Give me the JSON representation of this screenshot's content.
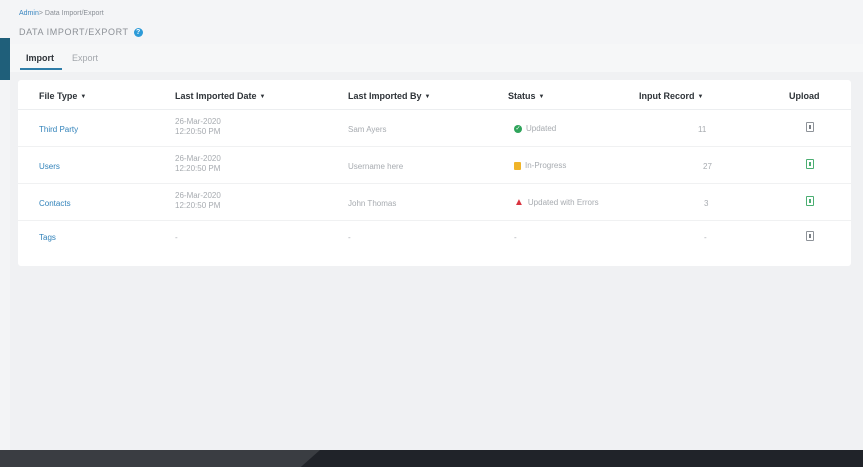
{
  "breadcrumb": {
    "link": "Admin",
    "separator": ">",
    "current": "Data Import/Export"
  },
  "page": {
    "title": "DATA IMPORT/EXPORT",
    "help_glyph": "?"
  },
  "tabs": [
    {
      "label": "Import",
      "active": true
    },
    {
      "label": "Export",
      "active": false
    }
  ],
  "table": {
    "columns": [
      {
        "label": "File Type",
        "sort": "▼"
      },
      {
        "label": "Last Imported Date",
        "sort": "▼"
      },
      {
        "label": "Last Imported By",
        "sort": "▼"
      },
      {
        "label": "Status",
        "sort": "▼"
      },
      {
        "label": "Input Record",
        "sort": "▼"
      },
      {
        "label": "Upload",
        "sort": ""
      }
    ],
    "rows": [
      {
        "file_type": "Third Party",
        "date": "26-Mar-2020",
        "time": "12:20:50 PM",
        "by": "Sam Ayers",
        "status": "Updated",
        "status_kind": "ok",
        "records": "11"
      },
      {
        "file_type": "Users",
        "date": "26-Mar-2020",
        "time": "12:20:50 PM",
        "by": "Username here",
        "status": "In-Progress",
        "status_kind": "progress",
        "records": "27"
      },
      {
        "file_type": "Contacts",
        "date": "26-Mar-2020",
        "time": "12:20:50 PM",
        "by": "John Thomas",
        "status": "Updated with Errors",
        "status_kind": "error",
        "records": "3"
      },
      {
        "file_type": "Tags",
        "date": "-",
        "time": "",
        "by": "-",
        "status": "-",
        "status_kind": "none",
        "records": "-"
      }
    ]
  },
  "colors": {
    "accent": "#2f7da8",
    "link": "#3182ba",
    "ok": "#2fa45b",
    "progress": "#f0b429",
    "error": "#d9333f"
  },
  "icons": {
    "help": "help-icon",
    "status_ok": "check-circle-icon",
    "status_progress": "hourglass-icon",
    "status_error": "warning-triangle-icon",
    "upload": "file-upload-icon"
  }
}
